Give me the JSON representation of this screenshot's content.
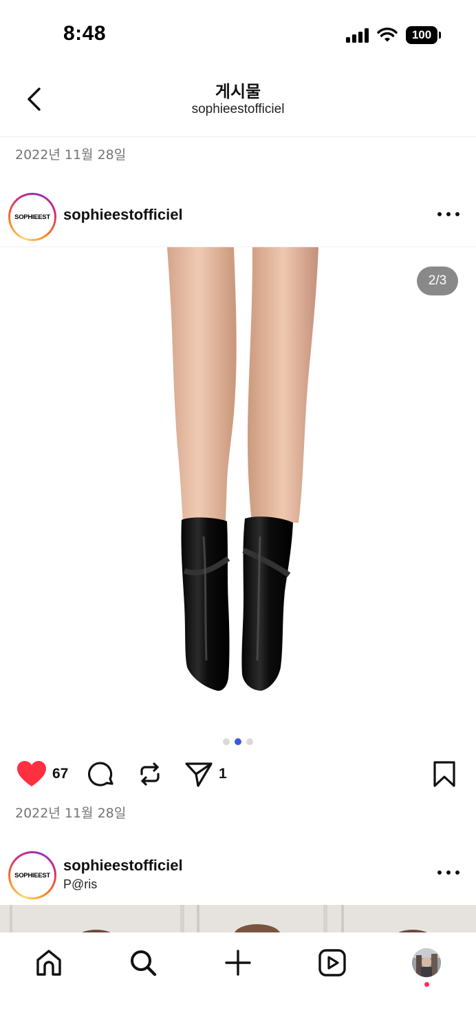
{
  "status_bar": {
    "time": "8:48",
    "battery": "100"
  },
  "header": {
    "title": "게시물",
    "subtitle": "sophieestofficiel"
  },
  "posts": [
    {
      "date": "2022년 11월 28일",
      "username": "sophieestofficiel",
      "avatar_text": "SOPHIEEST",
      "media_counter": "2/3",
      "carousel": {
        "total": 3,
        "active_index": 1
      },
      "likes": "67",
      "shares": "1",
      "liked": true,
      "post_date": "2022년 11월 28일"
    },
    {
      "username": "sophieestofficiel",
      "location": "P@ris",
      "avatar_text": "SOPHIEEST"
    }
  ],
  "tabbar": {
    "items": [
      "home-icon",
      "search-icon",
      "create-icon",
      "reels-icon",
      "profile-avatar"
    ]
  },
  "colors": {
    "like_red": "#ff3040",
    "active_dot": "#3b5bdb",
    "notification": "#ff2d55"
  }
}
